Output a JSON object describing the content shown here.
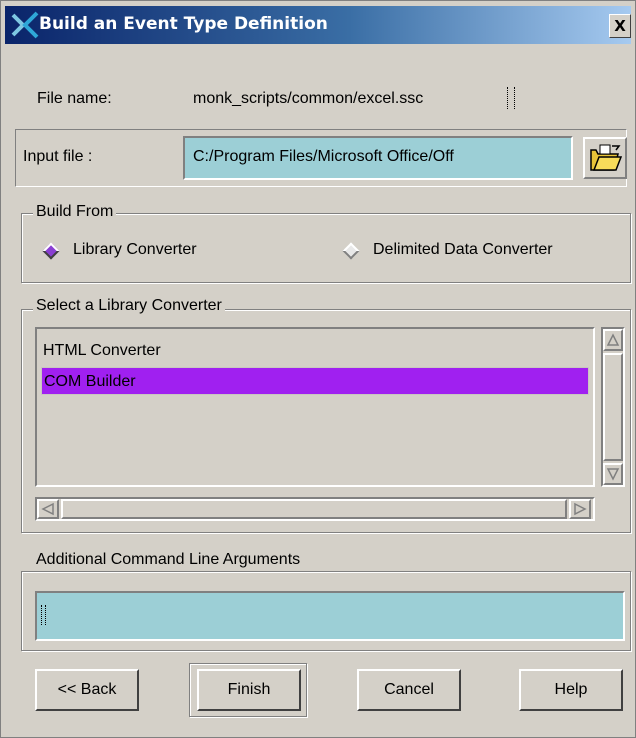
{
  "window": {
    "title": "Build an Event Type Definition",
    "close_label": "X"
  },
  "file_name": {
    "label": "File name:",
    "value": "monk_scripts/common/excel.ssc"
  },
  "input_file": {
    "label": "Input file :",
    "value": "C:/Program Files/Microsoft Office/Off",
    "browse_icon": "folder-open-icon"
  },
  "build_from": {
    "legend": "Build From",
    "options": [
      {
        "label": "Library Converter",
        "selected": true
      },
      {
        "label": "Delimited Data Converter",
        "selected": false
      }
    ]
  },
  "library_converter": {
    "legend": "Select a Library Converter",
    "items": [
      {
        "label": "HTML Converter",
        "selected": false
      },
      {
        "label": "COM Builder",
        "selected": true
      }
    ]
  },
  "arguments": {
    "legend": "Additional Command Line Arguments",
    "value": ""
  },
  "buttons": {
    "back": "<< Back",
    "finish": "Finish",
    "cancel": "Cancel",
    "help": "Help"
  },
  "colors": {
    "title_gradient_start": "#0a246a",
    "title_gradient_end": "#a6caf0",
    "field_bg": "#9ccfd6",
    "selection": "#a020f0",
    "radio_selected": "#8a3fd3",
    "dialog_bg": "#d4d0c8"
  }
}
